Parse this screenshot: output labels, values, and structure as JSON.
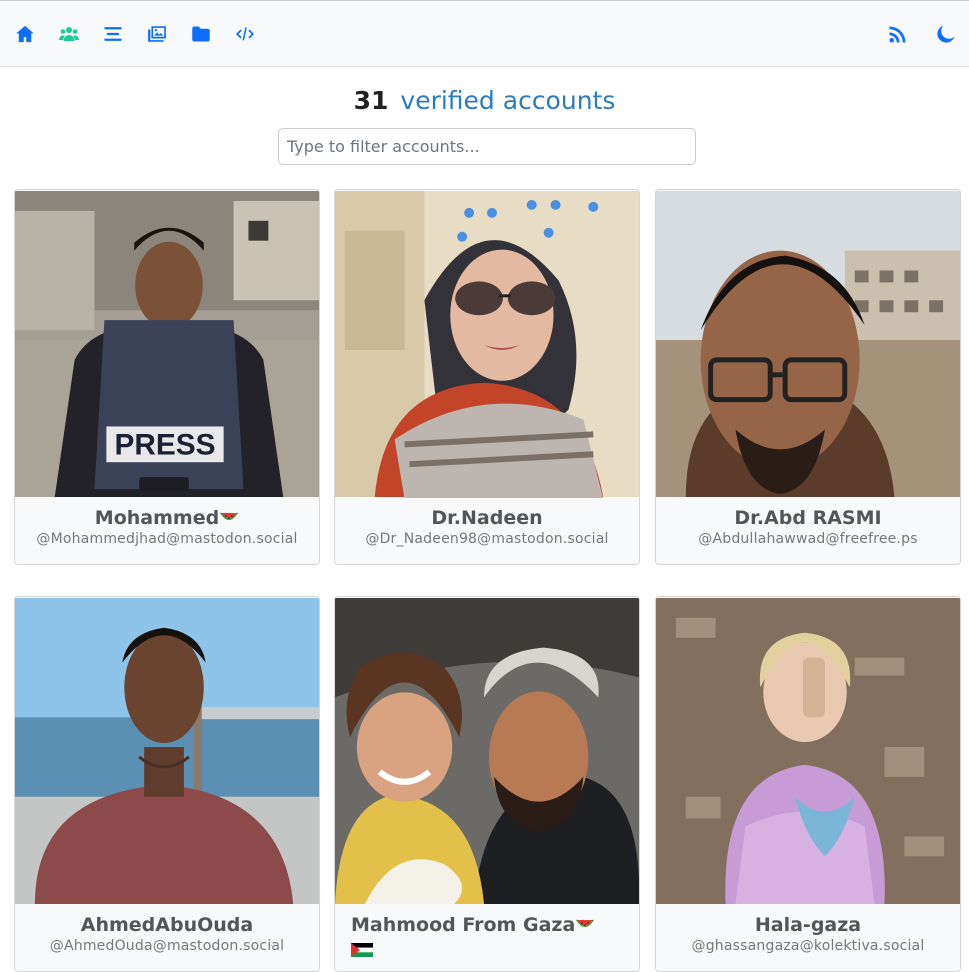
{
  "nav": {
    "left_icons": [
      "home-icon",
      "people-icon",
      "list-icon",
      "images-icon",
      "folder-icon",
      "code-icon"
    ],
    "right_icons": [
      "rss-icon",
      "moon-icon"
    ],
    "accent": "#0d6efd",
    "people_color": "#20c997"
  },
  "header": {
    "count": "31",
    "label": "verified accounts"
  },
  "search": {
    "placeholder": "Type to filter accounts...",
    "value": ""
  },
  "accounts": [
    {
      "name": "Mohammed",
      "suffix": "watermelon",
      "handle": "@Mohammedjhad@mastodon.social"
    },
    {
      "name": "Dr.Nadeen",
      "handle": "@Dr_Nadeen98@mastodon.social"
    },
    {
      "name": "Dr.Abd RASMI",
      "handle": "@Abdullahawwad@freefree.ps"
    },
    {
      "name": "AhmedAbuOuda",
      "handle": "@AhmedOuda@mastodon.social"
    },
    {
      "name": "Mahmood From Gaza",
      "suffix": "watermelon + palestine-flag",
      "handle": ""
    },
    {
      "name": "Hala-gaza",
      "handle": "@ghassangaza@kolektiva.social"
    }
  ]
}
